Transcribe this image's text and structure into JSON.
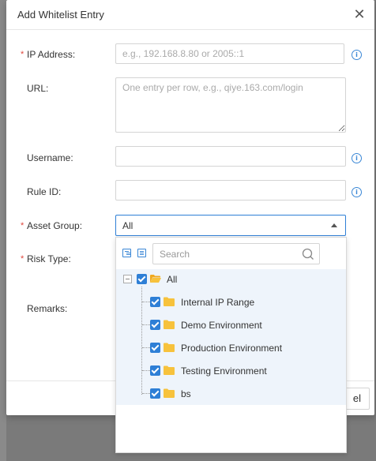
{
  "modal": {
    "title": "Add Whitelist Entry",
    "close_icon": "close-icon"
  },
  "form": {
    "ip_address": {
      "label": "IP Address:",
      "required": true,
      "placeholder": "e.g., 192.168.8.80 or 2005::1",
      "value": ""
    },
    "url": {
      "label": "URL:",
      "required": false,
      "placeholder": "One entry per row, e.g., qiye.163.com/login",
      "value": ""
    },
    "username": {
      "label": "Username:",
      "required": false,
      "value": ""
    },
    "rule_id": {
      "label": "Rule ID:",
      "required": false,
      "value": ""
    },
    "asset_group": {
      "label": "Asset Group:",
      "required": true,
      "selected": "All"
    },
    "risk_type": {
      "label": "Risk Type:",
      "required": true
    },
    "remarks": {
      "label": "Remarks:",
      "required": false
    }
  },
  "required_marker": "*",
  "info_icon": "i",
  "dropdown": {
    "search_placeholder": "Search",
    "toolbar_icons": [
      "expand-all-icon",
      "collapse-all-icon"
    ],
    "tree": [
      {
        "label": "All",
        "checked": true,
        "expanded": true
      },
      {
        "label": "Internal IP Range",
        "checked": true
      },
      {
        "label": "Demo Environment",
        "checked": true
      },
      {
        "label": "Production Environment",
        "checked": true
      },
      {
        "label": "Testing Environment",
        "checked": true
      },
      {
        "label": "bs",
        "checked": true
      }
    ]
  },
  "footer": {
    "cancel_label": "el"
  },
  "colors": {
    "accent": "#2e7fd6",
    "required": "#e0463c",
    "folder": "#f7c23c",
    "overlay": "#6b6b6b"
  }
}
